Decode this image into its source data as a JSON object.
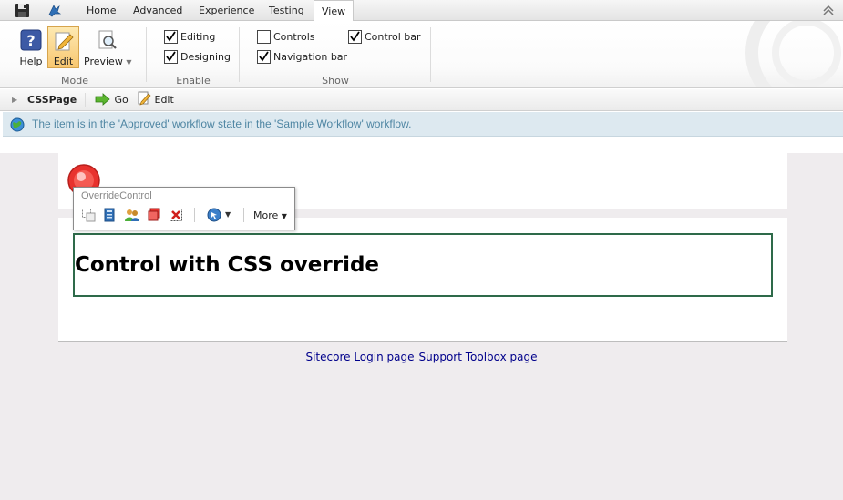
{
  "tabs": [
    {
      "label": "Home"
    },
    {
      "label": "Advanced"
    },
    {
      "label": "Experience"
    },
    {
      "label": "Testing"
    },
    {
      "label": "View",
      "active": true
    }
  ],
  "ribbon": {
    "mode": {
      "label": "Mode",
      "help": "Help",
      "edit": "Edit",
      "preview": "Preview"
    },
    "enable": {
      "label": "Enable",
      "editing": {
        "label": "Editing",
        "checked": true
      },
      "designing": {
        "label": "Designing",
        "checked": true
      }
    },
    "show": {
      "label": "Show",
      "controls": {
        "label": "Controls",
        "checked": false
      },
      "navigation_bar": {
        "label": "Navigation bar",
        "checked": true
      },
      "control_bar": {
        "label": "Control bar",
        "checked": true
      }
    }
  },
  "command_bar": {
    "page_name": "CSSPage",
    "go": "Go",
    "edit": "Edit"
  },
  "info": {
    "message": "The item is in the 'Approved' workflow state in the 'Sample Workflow' workflow."
  },
  "toolbox": {
    "title": "OverrideControl",
    "more": "More"
  },
  "content": {
    "heading": "Control with CSS override"
  },
  "footer": {
    "login_link": "Sitecore Login page",
    "support_link": "Support Toolbox page"
  },
  "colors": {
    "accent_border": "#2e6a4a",
    "info_text": "#4f86a3",
    "link": "#00008b"
  }
}
